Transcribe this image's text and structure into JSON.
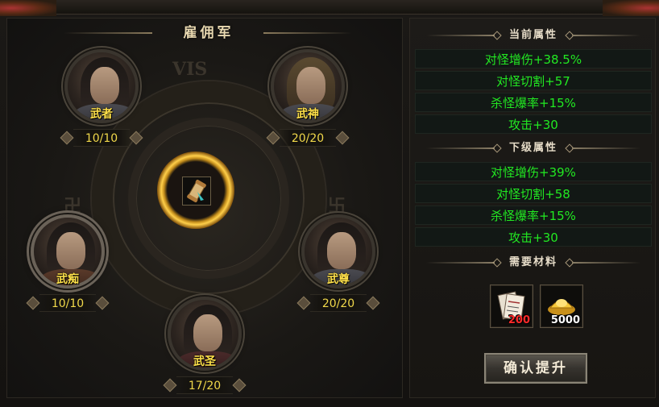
{
  "window": {
    "title": "雇佣军"
  },
  "heroes": [
    {
      "name": "武者",
      "count": "10/10"
    },
    {
      "name": "武神",
      "count": "20/20"
    },
    {
      "name": "武痴",
      "count": "10/10"
    },
    {
      "name": "武尊",
      "count": "20/20"
    },
    {
      "name": "武圣",
      "count": "17/20"
    }
  ],
  "center_item": {
    "icon": "scroll-icon"
  },
  "current_attrs": {
    "heading": "当前属性",
    "rows": [
      "对怪增伤+38.5%",
      "对怪切割+57",
      "杀怪爆率+15%",
      "攻击+30"
    ]
  },
  "next_attrs": {
    "heading": "下级属性",
    "rows": [
      "对怪增伤+39%",
      "对怪切割+58",
      "杀怪爆率+15%",
      "攻击+30"
    ]
  },
  "materials": {
    "heading": "需要材料",
    "items": [
      {
        "icon": "scroll-book-icon",
        "qty": "200",
        "qty_color": "#ff2a2a"
      },
      {
        "icon": "gold-ingot-icon",
        "qty": "5000",
        "qty_color": "#ffffff"
      }
    ]
  },
  "confirm_label": "确认提升"
}
